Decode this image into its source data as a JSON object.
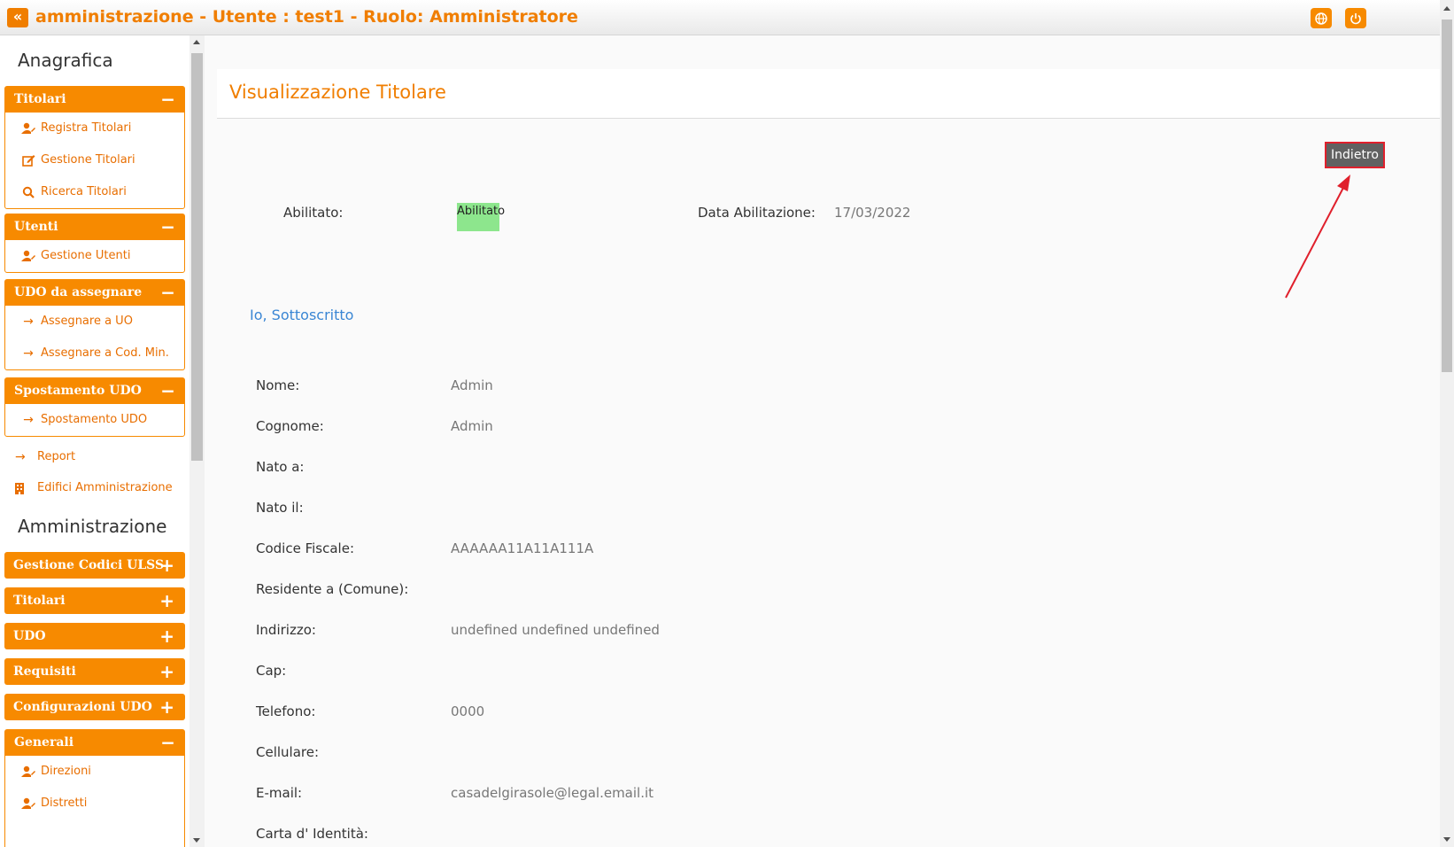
{
  "topbar": {
    "collapse_glyph": "«",
    "title": "amministrazione - Utente : test1 - Ruolo: Amministratore"
  },
  "sidebar": {
    "section_anagrafica": "Anagrafica",
    "panels_anagrafica": [
      {
        "title": "Titolari",
        "toggle": "−",
        "items": [
          {
            "label": "Registra Titolari",
            "icon": "user-edit-icon"
          },
          {
            "label": "Gestione Titolari",
            "icon": "edit-icon"
          },
          {
            "label": "Ricerca Titolari",
            "icon": "search-icon"
          }
        ]
      },
      {
        "title": "Utenti",
        "toggle": "−",
        "items": [
          {
            "label": "Gestione Utenti",
            "icon": "user-edit-icon"
          }
        ]
      },
      {
        "title": "UDO da assegnare",
        "toggle": "−",
        "items": [
          {
            "label": "Assegnare a UO",
            "icon": "arrow-right-icon"
          },
          {
            "label": "Assegnare a Cod. Min.",
            "icon": "arrow-right-icon"
          }
        ]
      },
      {
        "title": "Spostamento UDO",
        "toggle": "−",
        "items": [
          {
            "label": "Spostamento UDO",
            "icon": "arrow-right-icon"
          }
        ]
      }
    ],
    "links": [
      {
        "label": "Report",
        "icon": "arrow-right-icon"
      },
      {
        "label": "Edifici Amministrazione",
        "icon": "building-icon"
      }
    ],
    "section_amministrazione": "Amministrazione",
    "collapsed_panels": [
      {
        "title": "Gestione Codici ULSS",
        "toggle": "+"
      },
      {
        "title": "Titolari",
        "toggle": "+"
      },
      {
        "title": "UDO",
        "toggle": "+"
      },
      {
        "title": "Requisiti",
        "toggle": "+"
      },
      {
        "title": "Configurazioni UDO",
        "toggle": "+"
      }
    ],
    "generali": {
      "title": "Generali",
      "toggle": "−",
      "items": [
        {
          "label": "Direzioni",
          "icon": "user-edit-icon"
        },
        {
          "label": "Distretti",
          "icon": "user-edit-icon"
        }
      ]
    }
  },
  "main": {
    "page_title": "Visualizzazione Titolare",
    "back_button": "Indietro",
    "abilitato_label": "Abilitato:",
    "abilitato_value": "Abilitato",
    "data_abilitazione_label": "Data Abilitazione:",
    "data_abilitazione_value": "17/03/2022",
    "subheading": "Io, Sottoscritto",
    "fields": [
      {
        "label": "Nome:",
        "value": "Admin"
      },
      {
        "label": "Cognome:",
        "value": "Admin"
      },
      {
        "label": "Nato a:",
        "value": ""
      },
      {
        "label": "Nato il:",
        "value": ""
      },
      {
        "label": "Codice Fiscale:",
        "value": "AAAAAA11A11A111A"
      },
      {
        "label": "Residente a (Comune):",
        "value": ""
      },
      {
        "label": "Indirizzo:",
        "value": "undefined undefined undefined"
      },
      {
        "label": "Cap:",
        "value": ""
      },
      {
        "label": "Telefono:",
        "value": "0000"
      },
      {
        "label": "Cellulare:",
        "value": ""
      },
      {
        "label": "E-mail:",
        "value": "casadelgirasole@legal.email.it"
      },
      {
        "label": "Carta d' Identità:",
        "value": ""
      }
    ]
  },
  "colors": {
    "accent": "#f78a00",
    "title": "#f07e00",
    "link": "#3a86d4",
    "badge": "#8de68d",
    "annotation": "#e0202c"
  }
}
